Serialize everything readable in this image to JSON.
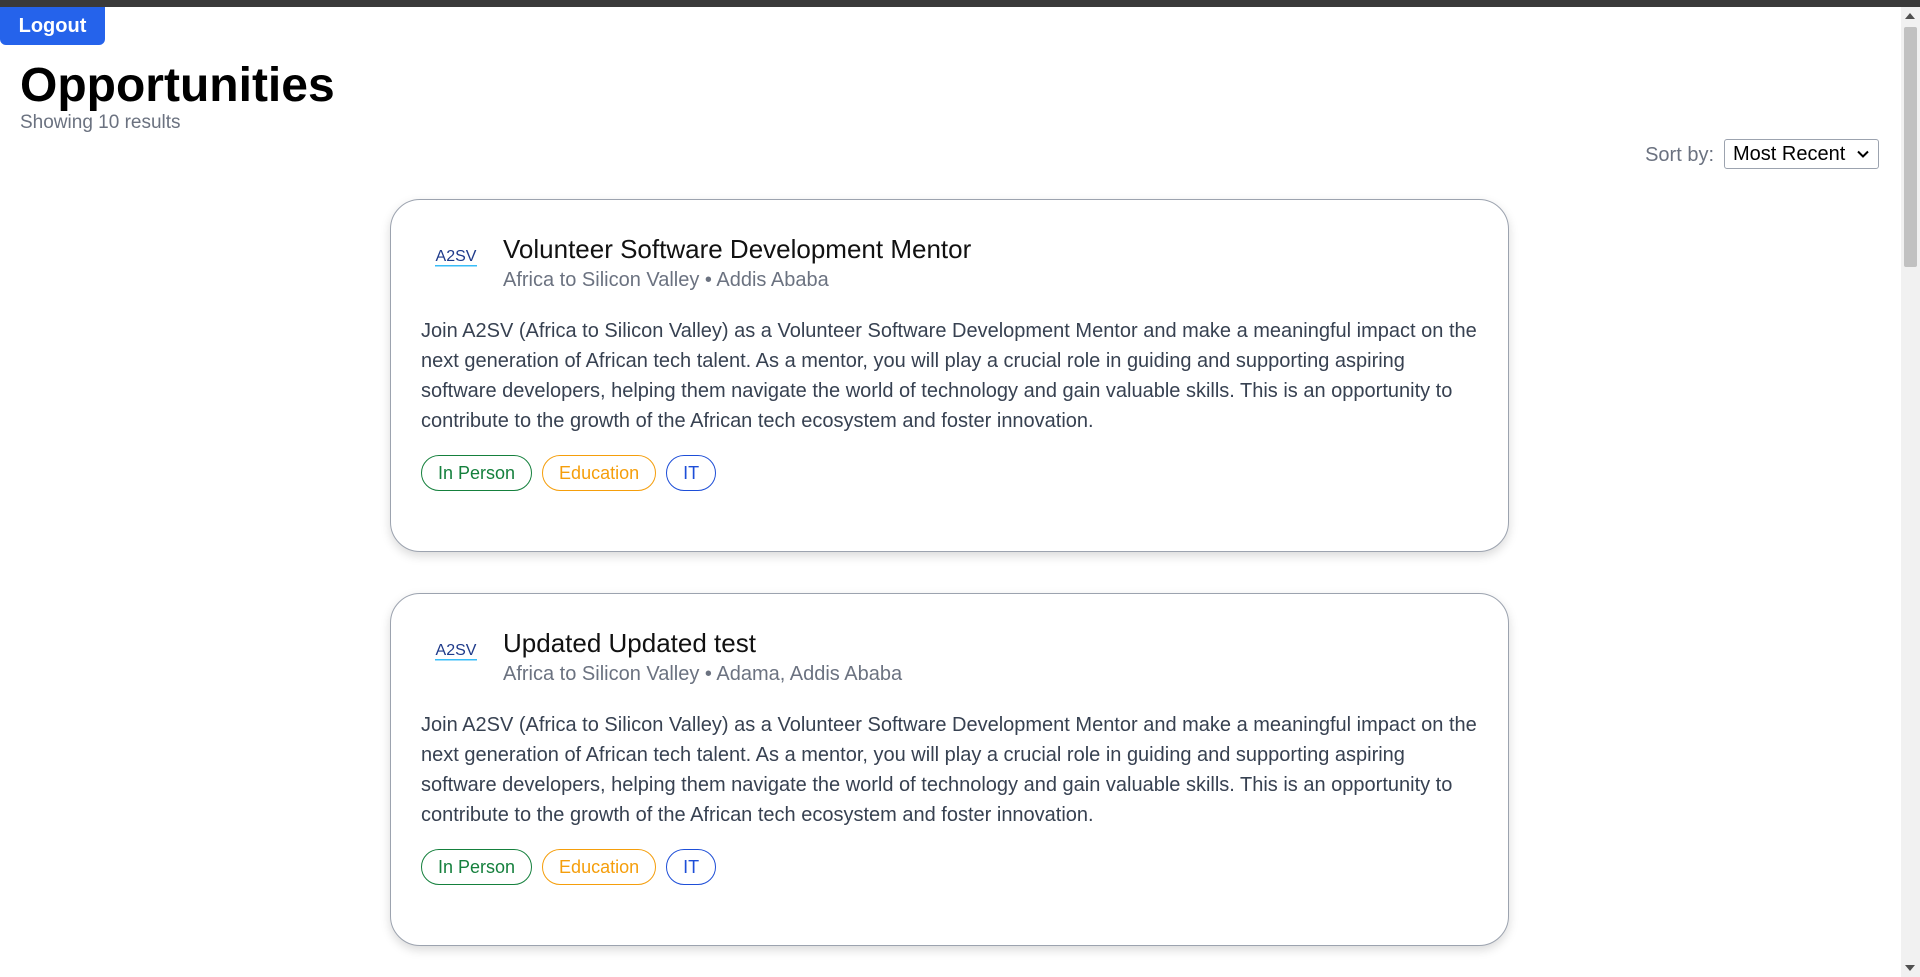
{
  "header": {
    "logout_label": "Logout",
    "title": "Opportunities",
    "results_text": "Showing 10 results",
    "sort_label": "Sort by:",
    "sort_value": "Most Recent"
  },
  "cards": [
    {
      "title": "Volunteer Software Development Mentor",
      "subtitle": "Africa to Silicon Valley • Addis Ababa",
      "description": "Join A2SV (Africa to Silicon Valley) as a Volunteer Software Development Mentor and make a meaningful impact on the next generation of African tech talent. As a mentor, you will play a crucial role in guiding and supporting aspiring software developers, helping them navigate the world of technology and gain valuable skills. This is an opportunity to contribute to the growth of the African tech ecosystem and foster innovation.",
      "tags": [
        "In Person",
        "Education",
        "IT"
      ]
    },
    {
      "title": "Updated Updated test",
      "subtitle": "Africa to Silicon Valley • Adama, Addis Ababa",
      "description": "Join A2SV (Africa to Silicon Valley) as a Volunteer Software Development Mentor and make a meaningful impact on the next generation of African tech talent. As a mentor, you will play a crucial role in guiding and supporting aspiring software developers, helping them navigate the world of technology and gain valuable skills. This is an opportunity to contribute to the growth of the African tech ecosystem and foster innovation.",
      "tags": [
        "In Person",
        "Education",
        "IT"
      ]
    }
  ],
  "logo": {
    "text": "A2SV",
    "color": "#1e3a8a",
    "accent": "#38bdf8"
  },
  "tag_colors": {
    "in_person": "#15803d",
    "education": "#f59e0b",
    "it": "#1d4ed8"
  },
  "accent_color": "#2563eb"
}
